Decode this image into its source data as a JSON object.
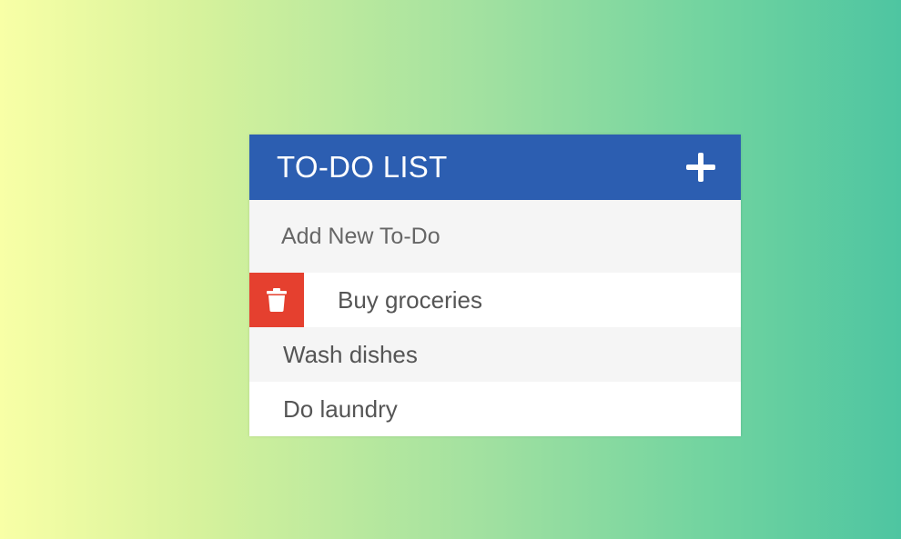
{
  "header": {
    "title": "TO-DO LIST"
  },
  "input": {
    "placeholder": "Add New To-Do"
  },
  "todos": [
    {
      "text": "Buy groceries",
      "delete_visible": true
    },
    {
      "text": "Wash dishes",
      "delete_visible": false
    },
    {
      "text": "Do laundry",
      "delete_visible": false
    }
  ],
  "colors": {
    "header_bg": "#2c5eb1",
    "delete_bg": "#e5402f",
    "text": "#555555"
  },
  "icons": {
    "add": "plus-icon",
    "delete": "trash-icon"
  }
}
